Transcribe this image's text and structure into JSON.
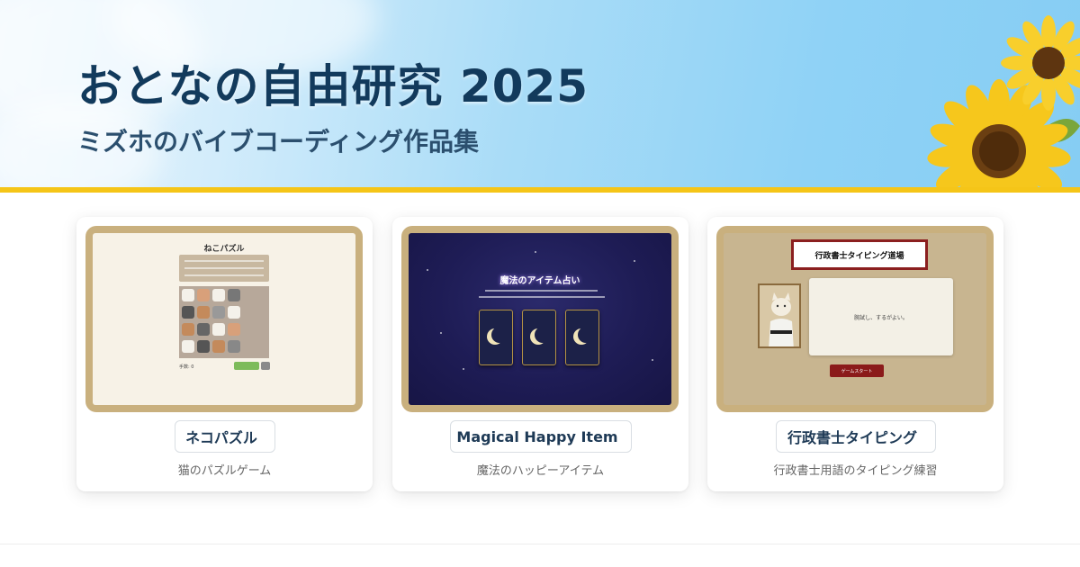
{
  "hero": {
    "title": "おとなの自由研究 2025",
    "subtitle": "ミズホのバイブコーディング作品集"
  },
  "colors": {
    "accent_bar": "#f5c518",
    "title_text": "#123a5c",
    "thumb_frame": "#c9b07e"
  },
  "cards": [
    {
      "link_label": "ネコパズル",
      "description": "猫のパズルゲーム",
      "link_icon": "external-link-icon",
      "thumb": {
        "title": "ねこパズル",
        "move_count": "手数: 0"
      }
    },
    {
      "link_label": "Magical Happy Item",
      "description": "魔法のハッピーアイテム",
      "link_icon": "external-link-icon",
      "thumb": {
        "title": "魔法のアイテム占い"
      }
    },
    {
      "link_label": "行政書士タイピング",
      "description": "行政書士用語のタイピング練習",
      "link_icon": "external-link-icon",
      "thumb": {
        "title": "行政書士タイピング道場",
        "prompt": "腕試し、するがよい。",
        "start_button": "ゲームスタート"
      }
    }
  ]
}
